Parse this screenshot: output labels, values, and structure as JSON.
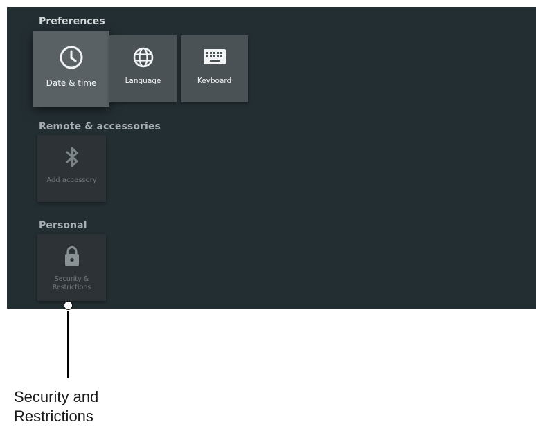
{
  "sections": {
    "preferences": {
      "title": "Preferences",
      "tiles": [
        {
          "label": "Date & time",
          "icon": "clock-icon",
          "focused": true
        },
        {
          "label": "Language",
          "icon": "globe-icon"
        },
        {
          "label": "Keyboard",
          "icon": "keyboard-icon"
        }
      ]
    },
    "remote": {
      "title": "Remote & accessories",
      "tiles": [
        {
          "label": "Add accessory",
          "icon": "bluetooth-icon"
        }
      ]
    },
    "personal": {
      "title": "Personal",
      "tiles": [
        {
          "label_line1": "Security &",
          "label_line2": "Restrictions",
          "icon": "lock-icon"
        }
      ]
    }
  },
  "annotation": {
    "line1": "Security and",
    "line2": "Restrictions"
  },
  "colors": {
    "screen_background": "#232e33",
    "tile": "#4b5255",
    "tile_focused": "#5a6164",
    "tile_dimmed": "#2c3235"
  }
}
